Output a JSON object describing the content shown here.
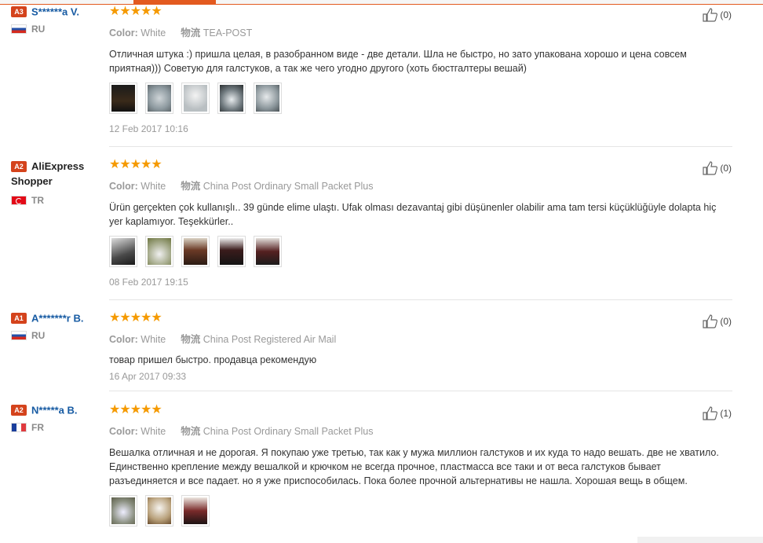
{
  "labels": {
    "color": "Color:",
    "logistics": "物流"
  },
  "reviews": [
    {
      "badge": "A3",
      "name": "S******a V.",
      "country": "RU",
      "rating": 5,
      "color": "White",
      "shipping": "TEA-POST",
      "text": "Отличная штука :) пришла целая, в разобранном виде - две детали. Шла не быстро, но зато упакована хорошо и цена совсем приятная))) Советую для галстуков, а так же чего угодно другого (хоть бюстгалтеры вешай)",
      "date": "12 Feb 2017 10:16",
      "helpful": "(0)",
      "photos": 5
    },
    {
      "badge": "A2",
      "name": "AliExpress Shopper",
      "country": "TR",
      "rating": 5,
      "color": "White",
      "shipping": "China Post Ordinary Small Packet Plus",
      "text": "Ürün gerçekten çok kullanışlı.. 39 günde elime ulaştı. Ufak olması dezavantaj gibi düşünenler olabilir ama tam tersi küçüklüğüyle dolapta hiç yer kaplamıyor. Teşekkürler..",
      "date": "08 Feb 2017 19:15",
      "helpful": "(0)",
      "photos": 5
    },
    {
      "badge": "A1",
      "name": "A*******r B.",
      "country": "RU",
      "rating": 5,
      "color": "White",
      "shipping": "China Post Registered Air Mail",
      "text": "товар пришел быстро. продавца рекомендую",
      "date": "16 Apr 2017 09:33",
      "helpful": "(0)",
      "photos": 0
    },
    {
      "badge": "A2",
      "name": "N*****a B.",
      "country": "FR",
      "rating": 5,
      "color": "White",
      "shipping": "China Post Ordinary Small Packet Plus",
      "text": "Вешалка отличная и не дорогая. Я покупаю уже третью, так как у мужа миллион галстуков и их куда то надо вешать. две не хватило. Единственно крепление между вешалкой и крючком не всегда прочное, пластмасса все таки и от веса галстуков бывает разъединяется и все падает. но я уже приспособилась. Пока более прочной альтернативы не нашла. Хорошая вещь в общем.",
      "date": "",
      "helpful": "(1)",
      "photos": 3
    }
  ],
  "colors": {
    "accent": "#e35a1f",
    "star": "#f59a00",
    "name_link": "#175ba3",
    "badge": "#d4431c"
  }
}
